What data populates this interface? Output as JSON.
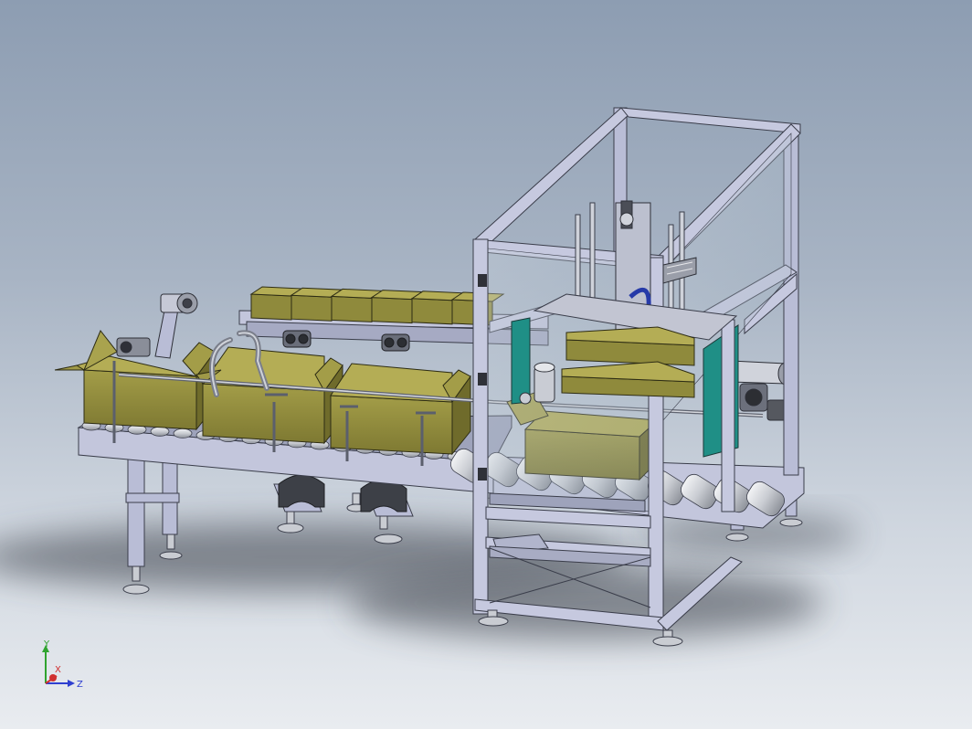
{
  "viewport": {
    "background_top": "#8d9db2",
    "background_bottom": "#e9ecf0"
  },
  "model": {
    "frame_color": "#b9bdd6",
    "frame_edge_color": "#3a3d4a",
    "carton_color": "#8f8a3c",
    "carton_top_color": "#b4ad55",
    "guard_panel_color": "#1f8f86",
    "roller_color": "#d8dbe0"
  },
  "triad": {
    "x_label": "X",
    "y_label": "Y",
    "z_label": "Z",
    "x_color": "#d03030",
    "y_color": "#2fa32f",
    "z_color": "#2f3fd0"
  }
}
